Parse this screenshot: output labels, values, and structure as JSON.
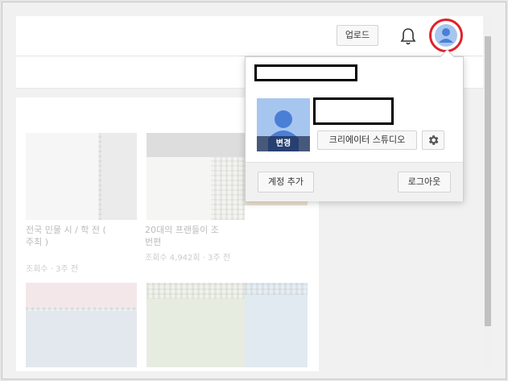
{
  "header": {
    "upload_label": "업로드",
    "notification_icon": "bell-icon",
    "avatar_icon": "user-avatar-icon",
    "highlight_color": "#e0222b"
  },
  "account_popup": {
    "change_photo_label": "변경",
    "creator_studio_label": "크리에이터 스튜디오",
    "settings_icon": "gear-icon",
    "add_account_label": "계정 추가",
    "logout_label": "로그아웃"
  },
  "videos": [
    {
      "title_line1": "전국 민물 시 / 학 전 (",
      "title_line2": "주최 )",
      "meta": "조회수 · 3주 전"
    },
    {
      "title_line1": "20대의 프랜들이 조",
      "title_line2": "번편",
      "meta": "조회수 4,942회 · 3주 전"
    }
  ],
  "colors": {
    "avatar_bg": "#a7c6ef",
    "avatar_figure": "#4a7fd6"
  }
}
